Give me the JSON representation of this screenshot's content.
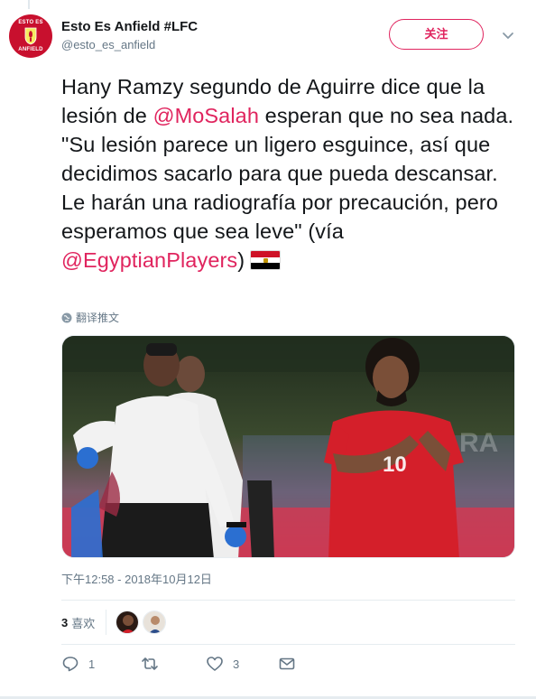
{
  "account": {
    "display_name": "Esto Es Anfield #LFC",
    "handle": "@esto_es_anfield",
    "avatar_top_text": "ESTO ES",
    "avatar_bottom_text": "ANFIELD"
  },
  "follow_button": {
    "label": "关注"
  },
  "tweet": {
    "part1": "Hany Ramzy segundo de Aguirre dice que la lesión de ",
    "mention1": "@MoSalah",
    "part2": " esperan que no sea nada. \"Su lesión  parece un ligero esguince, así que decidimos sacarlo para que pueda descansar. Le harán una radiografía por precaución, pero esperamos que sea leve\" (vía ",
    "mention2": "@EgyptianPlayers",
    "part3": ")",
    "flag_icon": "egypt-flag-icon"
  },
  "translate": {
    "label": "翻译推文",
    "icon": "globe-icon"
  },
  "photo": {
    "description_icon": "tweet-photo"
  },
  "timestamp": "下午12:58 - 2018年10月12日",
  "likes": {
    "count": "3",
    "label": "喜欢"
  },
  "actions": {
    "reply_count": "1",
    "retweet_count": "",
    "like_count": "3"
  },
  "colors": {
    "brand": "#e0245e",
    "muted": "#657786",
    "text": "#14171a",
    "divider": "#e6ecf0"
  }
}
